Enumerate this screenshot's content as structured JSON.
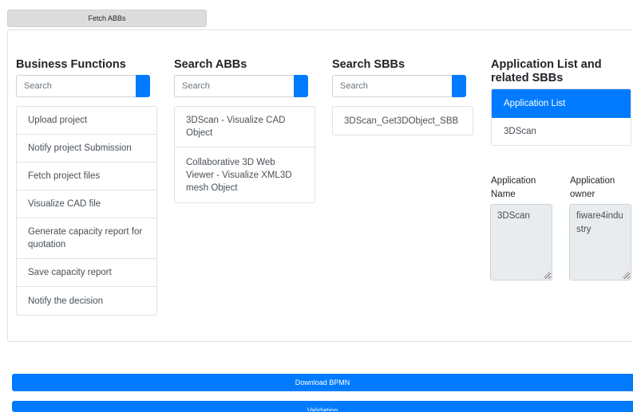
{
  "top": {
    "fetch_label": "Fetch ABBs"
  },
  "business": {
    "title": "Business Functions",
    "search_placeholder": "Search",
    "items": [
      "Upload project",
      "Notify project Submission",
      "Fetch project files",
      "Visualize CAD file",
      "Generate capacity report for quotation",
      "Save capacity report",
      "Notify the decision"
    ]
  },
  "abbs": {
    "title": "Search ABBs",
    "search_placeholder": "Search",
    "items": [
      "3DScan - Visualize CAD Object",
      "Collaborative 3D Web Viewer - Visualize XML3D mesh Object"
    ]
  },
  "sbbs": {
    "title": "Search SBBs",
    "search_placeholder": "Search",
    "items": [
      "3DScan_Get3DObject_SBB"
    ]
  },
  "apps": {
    "title": "Application List and related SBBs",
    "active_label": "Application List",
    "items": [
      "3DScan"
    ],
    "name_label": "Application Name",
    "owner_label": "Application owner",
    "name_value": "3DScan",
    "owner_value": "fiware4industry"
  },
  "bottom": {
    "download_label": "Download BPMN",
    "validation_label": "Validation"
  },
  "colors": {
    "primary": "#007bff",
    "border": "#dee2e6",
    "readonly_bg": "#e9ecef"
  }
}
